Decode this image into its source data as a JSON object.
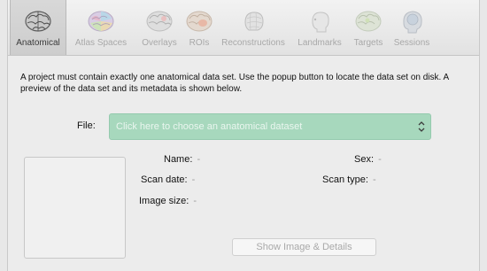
{
  "tabs": [
    {
      "label": "Anatomical",
      "icon": "brain-icon",
      "active": true
    },
    {
      "label": "Atlas Spaces",
      "icon": "atlas-brain-icon",
      "active": false
    },
    {
      "label": "Overlays",
      "icon": "overlay-brain-icon",
      "active": false
    },
    {
      "label": "ROIs",
      "icon": "roi-brain-icon",
      "active": false
    },
    {
      "label": "Reconstructions",
      "icon": "head-mesh-icon",
      "active": false
    },
    {
      "label": "Landmarks",
      "icon": "head-landmark-icon",
      "active": false
    },
    {
      "label": "Targets",
      "icon": "target-brain-icon",
      "active": false
    },
    {
      "label": "Sessions",
      "icon": "session-head-icon",
      "active": false
    }
  ],
  "intro": "A project must contain exactly one anatomical data set. Use the popup button to locate the data set on disk. A preview of the data set and its metadata is shown below.",
  "file": {
    "label": "File:",
    "placeholder": "Click here to choose an anatomical dataset"
  },
  "meta": {
    "name_label": "Name:",
    "name_value": "-",
    "sex_label": "Sex:",
    "sex_value": "-",
    "scan_date_label": "Scan date:",
    "scan_date_value": "-",
    "scan_type_label": "Scan type:",
    "scan_type_value": "-",
    "image_size_label": "Image size:",
    "image_size_value": "-"
  },
  "show_button": "Show Image & Details",
  "colors": {
    "select_bg": "#a7d8bd",
    "active_tab": "#d0d0d0",
    "disabled_text": "#a9a9a9"
  }
}
